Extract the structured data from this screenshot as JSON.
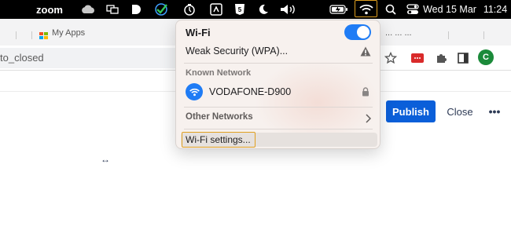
{
  "menubar": {
    "zoom_label": "zoom",
    "status_left_icons": [
      "cloud-icon",
      "window-share-icon",
      "d-app-icon",
      "check-mark-icon",
      "timer-icon",
      "screenshot-icon",
      "html5-icon",
      "night-mode-icon",
      "volume-icon",
      "battery-charging-icon"
    ],
    "wifi_icon": "wifi-icon",
    "search_icon": "spotlight-icon",
    "control_center_icon": "control-center-icon",
    "date": "Wed 15 Mar",
    "time": "11:24"
  },
  "browser": {
    "bookmark_partial": "My Apps",
    "bookmark_partial_right": "... ... ...",
    "url_partial": "to_closed",
    "avatar_initial": "C"
  },
  "page": {
    "publish_label": "Publish",
    "close_label": "Close",
    "more_label": "•••",
    "resize_label": "↔"
  },
  "wifi_menu": {
    "title": "Wi-Fi",
    "enabled": true,
    "current_network": "Weak Security (WPA)...",
    "known_section": "Known Network",
    "known_network": "VODAFONE-D900",
    "other_section": "Other Networks",
    "settings_label": "Wi-Fi settings..."
  },
  "colors": {
    "accent_blue": "#1f7cf5",
    "publish_blue": "#0b5fd9",
    "highlight_border": "#e0a020",
    "menubar_bg": "#000000"
  }
}
